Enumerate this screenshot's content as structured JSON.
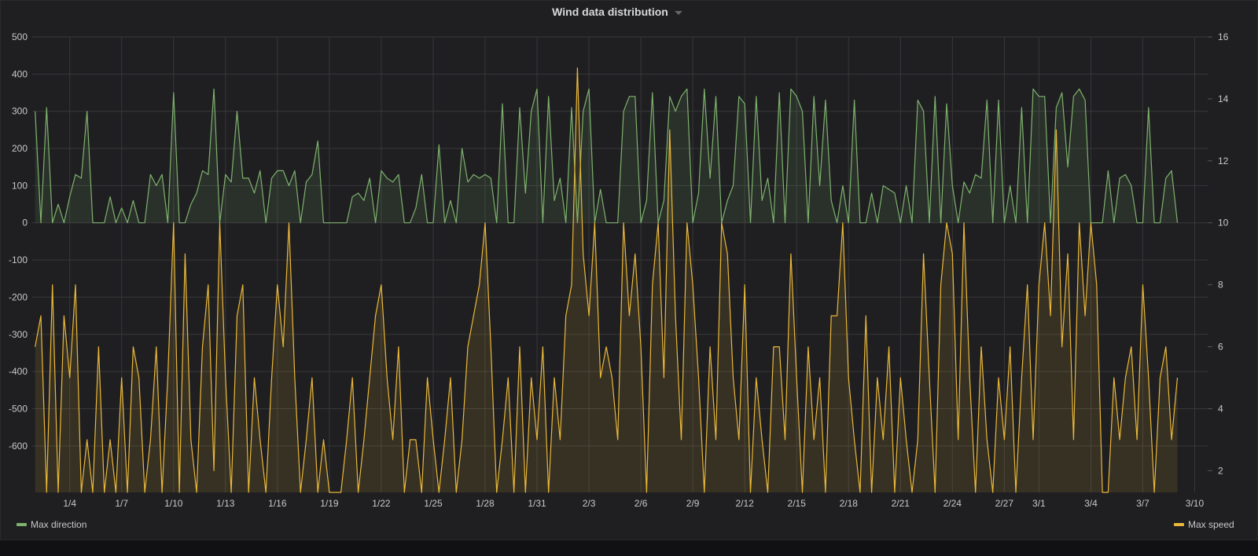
{
  "panel": {
    "title": "Wind data distribution",
    "menu_icon": "caret-down-icon"
  },
  "chart_data": {
    "type": "line",
    "title": "Wind data distribution",
    "x_start": "01-02 00:00",
    "x_step_hours": 8,
    "xlim": [
      "01-01 20:00",
      "03-10 18:00"
    ],
    "x_ticks": [
      "1/4",
      "1/7",
      "1/10",
      "1/13",
      "1/16",
      "1/19",
      "1/22",
      "1/25",
      "1/28",
      "1/31",
      "2/3",
      "2/6",
      "2/9",
      "2/12",
      "2/15",
      "2/18",
      "2/21",
      "2/24",
      "2/27",
      "3/1",
      "3/4",
      "3/7",
      "3/10"
    ],
    "y_left": {
      "lim": [
        -725,
        500
      ],
      "ticks": [
        500,
        400,
        300,
        200,
        100,
        0,
        -100,
        -200,
        -300,
        -400,
        -500,
        -600
      ]
    },
    "y_right": {
      "lim": [
        1.3,
        16
      ],
      "ticks": [
        16,
        14,
        12,
        10,
        8,
        6,
        4,
        2
      ]
    },
    "grid": true,
    "legend_placement": "bottom",
    "series": [
      {
        "name": "Max direction",
        "axis": "left",
        "color": "#7eb26d",
        "fill": true,
        "values": [
          300,
          0,
          310,
          0,
          50,
          0,
          70,
          130,
          120,
          300,
          0,
          0,
          0,
          70,
          0,
          40,
          0,
          60,
          0,
          0,
          130,
          100,
          130,
          0,
          350,
          0,
          0,
          50,
          80,
          140,
          130,
          360,
          0,
          130,
          110,
          300,
          120,
          120,
          80,
          140,
          0,
          120,
          140,
          140,
          100,
          140,
          0,
          110,
          130,
          220,
          0,
          0,
          0,
          0,
          0,
          70,
          80,
          60,
          120,
          0,
          140,
          120,
          110,
          130,
          0,
          0,
          40,
          130,
          0,
          0,
          210,
          0,
          60,
          0,
          200,
          110,
          130,
          120,
          130,
          120,
          0,
          320,
          0,
          0,
          310,
          80,
          300,
          360,
          0,
          340,
          60,
          120,
          0,
          310,
          0,
          300,
          360,
          0,
          90,
          0,
          0,
          0,
          300,
          340,
          340,
          0,
          60,
          350,
          0,
          60,
          340,
          300,
          340,
          360,
          0,
          80,
          360,
          120,
          340,
          0,
          60,
          100,
          340,
          320,
          0,
          340,
          60,
          120,
          0,
          350,
          0,
          360,
          340,
          300,
          0,
          340,
          100,
          330,
          60,
          0,
          100,
          0,
          330,
          0,
          0,
          80,
          0,
          100,
          90,
          80,
          0,
          100,
          0,
          330,
          300,
          0,
          340,
          0,
          320,
          100,
          0,
          110,
          80,
          130,
          120,
          330,
          0,
          330,
          0,
          100,
          0,
          310,
          0,
          360,
          340,
          340,
          0,
          310,
          350,
          150,
          340,
          360,
          330,
          0,
          0,
          0,
          140,
          0,
          120,
          130,
          100,
          0,
          0,
          310,
          0,
          0,
          120,
          140,
          0
        ]
      },
      {
        "name": "Max speed",
        "axis": "right",
        "color": "#eab839",
        "fill": true,
        "values": [
          6,
          7,
          1,
          8,
          1,
          7,
          5,
          8,
          1,
          3,
          1,
          6,
          1,
          3,
          1,
          5,
          1,
          6,
          5,
          1,
          3,
          6,
          1,
          5,
          10,
          1,
          9,
          3,
          1,
          6,
          8,
          2,
          10,
          5,
          1,
          7,
          8,
          1,
          5,
          3,
          1,
          5,
          8,
          6,
          10,
          5,
          1,
          3,
          5,
          1,
          3,
          1,
          1,
          1,
          3,
          5,
          1,
          3,
          5,
          7,
          8,
          5,
          3,
          6,
          1,
          3,
          3,
          1,
          5,
          3,
          1,
          3,
          5,
          1,
          3,
          6,
          7,
          8,
          10,
          6,
          1,
          3,
          5,
          1,
          6,
          1,
          5,
          3,
          6,
          1,
          5,
          3,
          7,
          8,
          15,
          9,
          7,
          10,
          5,
          6,
          5,
          3,
          10,
          7,
          9,
          6,
          1,
          8,
          10,
          5,
          13,
          7,
          3,
          10,
          8,
          5,
          1,
          6,
          3,
          10,
          9,
          5,
          3,
          8,
          1,
          5,
          3,
          1,
          6,
          6,
          3,
          9,
          5,
          1,
          6,
          3,
          5,
          1,
          7,
          7,
          10,
          5,
          3,
          1,
          7,
          1,
          5,
          3,
          6,
          1,
          5,
          3,
          1,
          3,
          9,
          5,
          1,
          8,
          10,
          9,
          3,
          10,
          5,
          1,
          6,
          3,
          1,
          5,
          3,
          6,
          1,
          5,
          8,
          3,
          8,
          10,
          7,
          13,
          6,
          9,
          3,
          10,
          7,
          10,
          8,
          1,
          1,
          5,
          3,
          5,
          6,
          3,
          8,
          5,
          1,
          5,
          6,
          3,
          5
        ]
      }
    ]
  },
  "legend": {
    "left_label": "Max direction",
    "right_label": "Max speed"
  }
}
